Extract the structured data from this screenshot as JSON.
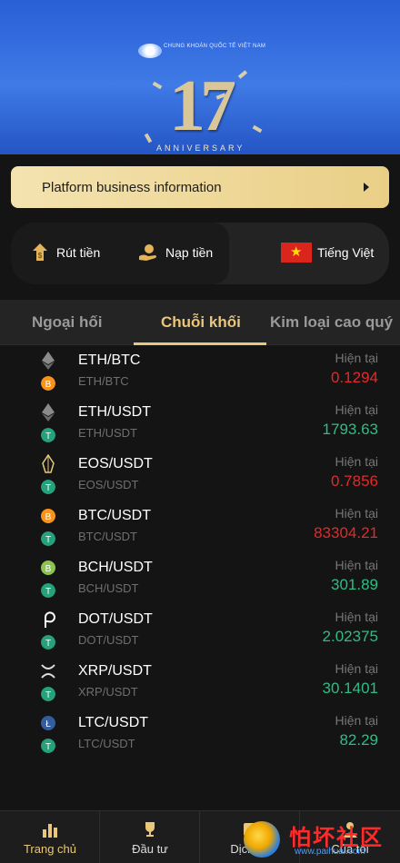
{
  "banner": {
    "logo_text": "CHUNG KHOÁN QUỐC TẾ VIỆT NAM",
    "number": "17",
    "anniversary": "ANNIVERSARY"
  },
  "notice": {
    "label": "Platform business information"
  },
  "actions": {
    "withdraw": "Rút tiền",
    "deposit": "Nạp tiền",
    "language": "Tiếng Việt"
  },
  "tabs": [
    {
      "label": "Ngoại hối"
    },
    {
      "label": "Chuỗi khối"
    },
    {
      "label": "Kim loại cao quý"
    }
  ],
  "rows": [
    {
      "pair": "ETH/BTC",
      "sub": "ETH/BTC",
      "label": "Hiện tại",
      "price": "0.1294",
      "trend": "down",
      "base_icon": "ethereum-icon",
      "quote_icon": "bitcoin-icon"
    },
    {
      "pair": "ETH/USDT",
      "sub": "ETH/USDT",
      "label": "Hiện tại",
      "price": "1793.63",
      "trend": "up",
      "base_icon": "ethereum-icon",
      "quote_icon": "tether-icon"
    },
    {
      "pair": "EOS/USDT",
      "sub": "EOS/USDT",
      "label": "Hiện tại",
      "price": "0.7856",
      "trend": "down",
      "base_icon": "eos-icon",
      "quote_icon": "tether-icon"
    },
    {
      "pair": "BTC/USDT",
      "sub": "BTC/USDT",
      "label": "Hiện tại",
      "price": "83304.21",
      "trend": "down",
      "base_icon": "bitcoin-icon",
      "quote_icon": "tether-icon"
    },
    {
      "pair": "BCH/USDT",
      "sub": "BCH/USDT",
      "label": "Hiện tại",
      "price": "301.89",
      "trend": "up",
      "base_icon": "bitcoin-cash-icon",
      "quote_icon": "tether-icon"
    },
    {
      "pair": "DOT/USDT",
      "sub": "DOT/USDT",
      "label": "Hiện tại",
      "price": "2.02375",
      "trend": "up",
      "base_icon": "polkadot-icon",
      "quote_icon": "tether-icon"
    },
    {
      "pair": "XRP/USDT",
      "sub": "XRP/USDT",
      "label": "Hiện tại",
      "price": "30.1401",
      "trend": "up",
      "base_icon": "xrp-icon",
      "quote_icon": "tether-icon"
    },
    {
      "pair": "LTC/USDT",
      "sub": "LTC/USDT",
      "label": "Hiện tại",
      "price": "82.29",
      "trend": "up",
      "base_icon": "litecoin-icon",
      "quote_icon": "tether-icon"
    }
  ],
  "bottom_nav": [
    {
      "label": "Trang chủ",
      "icon": "bar-chart-icon"
    },
    {
      "label": "Đầu tư",
      "icon": "trophy-icon"
    },
    {
      "label": "Dịch vụ",
      "icon": "service-icon"
    },
    {
      "label": "Của tôi",
      "icon": "user-icon"
    }
  ],
  "watermark": {
    "title": "怕坏社区",
    "url": "www.paihuai.com"
  },
  "colors": {
    "accent": "#e8c77a",
    "up": "#2ebd85",
    "down": "#e02b2b",
    "background": "#141414"
  }
}
